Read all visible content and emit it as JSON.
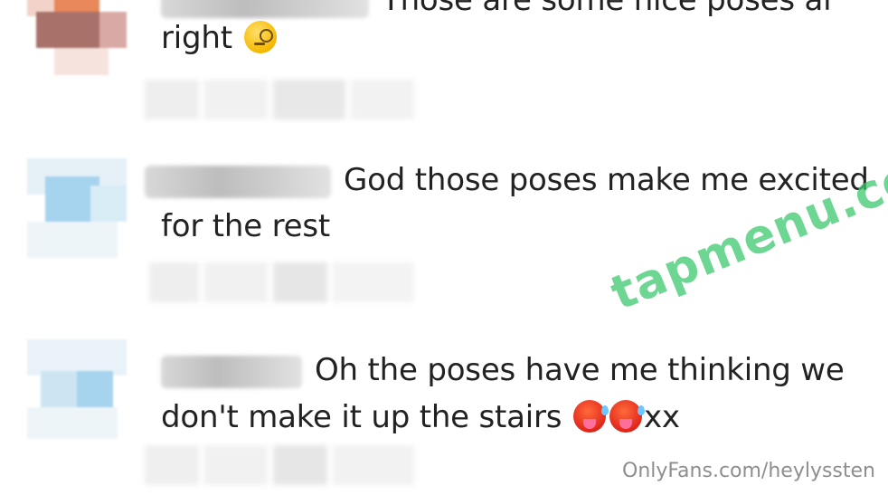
{
  "comments": [
    {
      "line1": "Those are some nice poses al",
      "line2": "right",
      "emoji": "face-with-monocle-icon",
      "avatar_colors": [
        "#e8875a",
        "#a8726a",
        "#d9a9a5",
        "#f3d3c9"
      ]
    },
    {
      "line1": "God those poses make me excited",
      "line2": "for the rest",
      "avatar_colors": [
        "#cfe4f3",
        "#a6d3ee",
        "#e6f0f7",
        "#d8ecf6"
      ]
    },
    {
      "line1": "Oh the poses have me thinking we",
      "line2": "don't make it up the stairs",
      "line2_suffix": "xx",
      "emoji": [
        "hot-face-icon",
        "hot-face-icon"
      ],
      "avatar_colors": [
        "#d8ecf6",
        "#a6d3ee",
        "#e8f2f8",
        "#cde5f3"
      ]
    }
  ],
  "watermark": "tapmenu.com",
  "footer": {
    "url": "OnlyFans.com/heylyssten"
  }
}
